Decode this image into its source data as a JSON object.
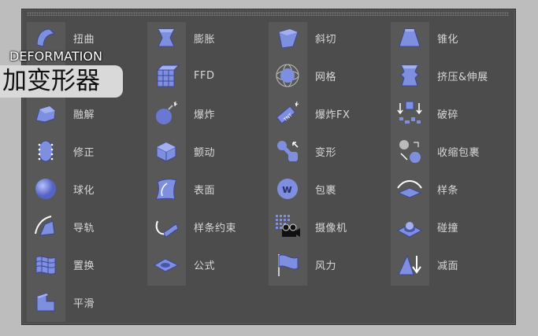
{
  "overlay": {
    "title_en": "DEFORMATION",
    "title_cn": "加变形器"
  },
  "columns": [
    [
      {
        "label": "扭曲",
        "icon": "bend-icon"
      },
      {
        "label": "",
        "icon": "bulge-icon"
      },
      {
        "label": "融解",
        "icon": "melt-icon"
      },
      {
        "label": "修正",
        "icon": "correction-icon"
      },
      {
        "label": "球化",
        "icon": "spherify-icon"
      },
      {
        "label": "导轨",
        "icon": "rail-icon"
      },
      {
        "label": "置换",
        "icon": "displacer-icon"
      },
      {
        "label": "平滑",
        "icon": "smoothing-icon"
      }
    ],
    [
      {
        "label": "膨胀",
        "icon": "bulge-icon"
      },
      {
        "label": "FFD",
        "icon": "ffd-icon"
      },
      {
        "label": "爆炸",
        "icon": "explosion-icon"
      },
      {
        "label": "颤动",
        "icon": "jiggle-icon"
      },
      {
        "label": "表面",
        "icon": "surface-icon"
      },
      {
        "label": "样条约束",
        "icon": "spline-wrap-icon"
      },
      {
        "label": "公式",
        "icon": "formula-icon"
      }
    ],
    [
      {
        "label": "斜切",
        "icon": "shear-icon"
      },
      {
        "label": "网格",
        "icon": "mesh-icon"
      },
      {
        "label": "爆炸FX",
        "icon": "explosion-fx-icon"
      },
      {
        "label": "变形",
        "icon": "morph-icon"
      },
      {
        "label": "包裹",
        "icon": "wrap-icon"
      },
      {
        "label": "摄像机",
        "icon": "camera-icon"
      },
      {
        "label": "风力",
        "icon": "wind-icon"
      }
    ],
    [
      {
        "label": "锥化",
        "icon": "taper-icon"
      },
      {
        "label": "挤压&伸展",
        "icon": "squash-stretch-icon"
      },
      {
        "label": "破碎",
        "icon": "shatter-icon"
      },
      {
        "label": "收缩包裹",
        "icon": "shrink-wrap-icon"
      },
      {
        "label": "样条",
        "icon": "spline-icon"
      },
      {
        "label": "碰撞",
        "icon": "collision-icon"
      },
      {
        "label": "减面",
        "icon": "polygon-reduction-icon"
      }
    ]
  ],
  "colors": {
    "panel": "#4c4c4c",
    "strip": "#585858",
    "icon_fill": "#7f8fe0",
    "icon_dark": "#4a56a8",
    "label": "#d6d6d6"
  }
}
